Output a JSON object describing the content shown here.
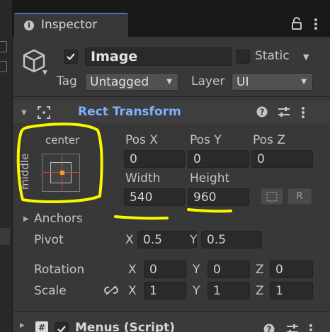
{
  "tab": {
    "label": "Inspector",
    "icons": [
      "lock-icon",
      "kebab-menu-icon"
    ]
  },
  "header": {
    "active_checked": true,
    "name_value": "Image",
    "static_label": "Static",
    "static_checked": false,
    "tag_label": "Tag",
    "tag_value": "Untagged",
    "layer_label": "Layer",
    "layer_value": "UI"
  },
  "rect_transform": {
    "title": "Rect Transform",
    "anchor_preset": {
      "horizontal": "center",
      "vertical": "middle"
    },
    "pos_x": {
      "label": "Pos X",
      "value": "0"
    },
    "pos_y": {
      "label": "Pos Y",
      "value": "0"
    },
    "pos_z": {
      "label": "Pos Z",
      "value": "0"
    },
    "width": {
      "label": "Width",
      "value": "540"
    },
    "height": {
      "label": "Height",
      "value": "960"
    },
    "raw_edit_label": "R",
    "anchors_label": "Anchors",
    "pivot": {
      "label": "Pivot",
      "x_label": "X",
      "x": "0.5",
      "y_label": "Y",
      "y": "0.5"
    },
    "rotation": {
      "label": "Rotation",
      "x_label": "X",
      "x": "0",
      "y_label": "Y",
      "y": "0",
      "z_label": "Z",
      "z": "0"
    },
    "scale": {
      "label": "Scale",
      "x_label": "X",
      "x": "1",
      "y_label": "Y",
      "y": "1",
      "z_label": "Z",
      "z": "1"
    }
  },
  "next_component": {
    "title": "Menus (Script)",
    "enabled": true
  },
  "colors": {
    "accent_title": "#7cb2ff",
    "annotation": "#f7f700",
    "tab_highlight": "#3a79bb"
  }
}
